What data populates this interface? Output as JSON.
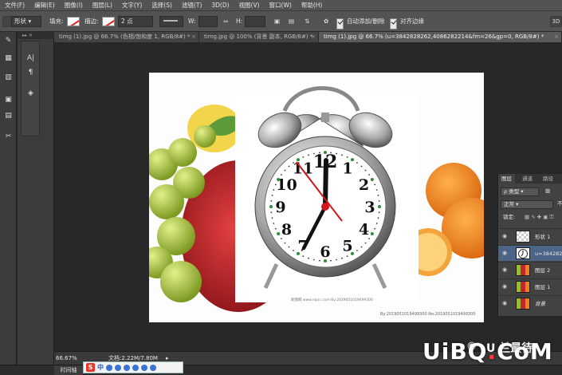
{
  "menu": [
    "文件(F)",
    "编辑(E)",
    "图像(I)",
    "图层(L)",
    "文字(Y)",
    "选择(S)",
    "滤镜(T)",
    "3D(D)",
    "视图(V)",
    "窗口(W)",
    "帮助(H)"
  ],
  "options": {
    "mode": "形状",
    "fill_label": "填充:",
    "stroke_label": "描边:",
    "stroke_width": "2 点",
    "w_label": "W:",
    "h_label": "H:",
    "auto_add_delete": "自动添加/删除",
    "align_edges": "对齐边缘",
    "right_btn": "3D"
  },
  "tabs": [
    {
      "label": "timg (1).jpg @ 66.7% (色相/饱和度 1, RGB/8#) *",
      "active": false
    },
    {
      "label": "timg.jpg @ 100% (背景 副本, RGB/8#) *",
      "active": false
    },
    {
      "label": "timg (1).jpg @ 66.7% (u=3842828262,4086282214&fm=26&gp=0, RGB/8#) *",
      "active": true
    }
  ],
  "canvas": {
    "wm_left": "昵图网 www.nipic.com",
    "wm_center": "昵图网 www.nipic.com By:2019051019499300",
    "wm_right": "By:2019051019499300·No:2019051019499300",
    "colors": {
      "apple": "#c1272d",
      "grape": "#9cb93a",
      "orange": "#f07f1c",
      "lemon": "#f2d54a",
      "leaf": "#5d9a3a"
    }
  },
  "clock": {
    "numbers": [
      "12",
      "1",
      "2",
      "3",
      "4",
      "5",
      "6",
      "7",
      "8",
      "9",
      "10",
      "11"
    ],
    "hand_color": "#111111",
    "second_hand_color": "#d0161b"
  },
  "layers": {
    "tabs": [
      "图层",
      "通道",
      "路径"
    ],
    "filter": "类型",
    "blend": "正常",
    "opacity_label": "不",
    "lock_label": "锁定:",
    "rows": [
      {
        "name": "形状 1",
        "selected": false,
        "thumb": "checker"
      },
      {
        "name": "u=38428282",
        "selected": true,
        "thumb": "clock"
      },
      {
        "name": "图层 2",
        "selected": false,
        "thumb": "fruit"
      },
      {
        "name": "图层 1",
        "selected": false,
        "thumb": "fruit"
      },
      {
        "name": "背景",
        "selected": false,
        "thumb": "fruit"
      }
    ]
  },
  "status": {
    "zoom": "66.67%",
    "doc": "文档:2.22M/7.80M"
  },
  "bottom": {
    "timeline": "时间轴"
  },
  "ime": {
    "s": "S",
    "zh": "中"
  },
  "brand": {
    "uibq_pre": "UiBQ",
    "uibq_dot": ".",
    "uibq_post": "CoM",
    "wechat_text": "U 兰最待"
  }
}
